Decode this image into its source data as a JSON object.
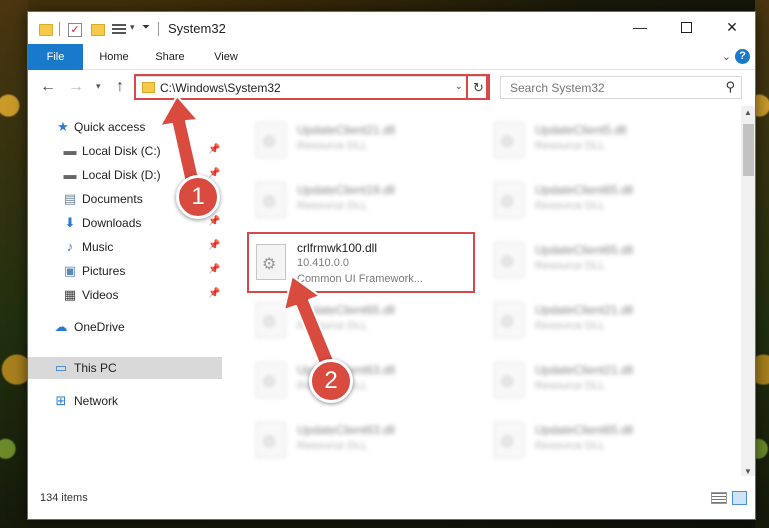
{
  "window": {
    "title": "System32"
  },
  "quick_access_toolbar": {
    "icons": [
      "folder-icon",
      "properties-check-icon",
      "new-folder-icon",
      "properties-icon",
      "dropdown-icon"
    ]
  },
  "ribbon": {
    "tabs": [
      "File",
      "Home",
      "Share",
      "View"
    ],
    "accent_color": "#1979ca",
    "help_label": "?"
  },
  "navigation": {
    "address": "C:\\Windows\\System32",
    "search_placeholder": "Search System32"
  },
  "sidebar": {
    "items": [
      {
        "label": "Quick access",
        "icon": "star-icon"
      },
      {
        "label": "Local Disk (C:)",
        "icon": "drive-icon",
        "pinned": true
      },
      {
        "label": "Local Disk (D:)",
        "icon": "drive-icon",
        "pinned": true
      },
      {
        "label": "Documents",
        "icon": "documents-icon",
        "pinned": true
      },
      {
        "label": "Downloads",
        "icon": "downloads-icon",
        "pinned": true
      },
      {
        "label": "Music",
        "icon": "music-icon",
        "pinned": true
      },
      {
        "label": "Pictures",
        "icon": "pictures-icon",
        "pinned": true
      },
      {
        "label": "Videos",
        "icon": "videos-icon",
        "pinned": true
      },
      {
        "label": "OneDrive",
        "icon": "cloud-icon"
      },
      {
        "label": "This PC",
        "icon": "computer-icon",
        "selected": true
      },
      {
        "label": "Network",
        "icon": "network-icon"
      }
    ]
  },
  "files": {
    "col_left": [
      {
        "name": "UpdateClient21.dll",
        "desc": "Resource DLL"
      },
      {
        "name": "UpdateClient19.dll",
        "desc": "Resource DLL"
      },
      {
        "name": "UpdateClient65.dll",
        "desc": "Resource DLL"
      },
      {
        "name": "UpdateClient63.dll",
        "desc": "Resource DLL"
      },
      {
        "name": "UpdateClient63.dll",
        "desc": "Resource DLL"
      }
    ],
    "col_right": [
      {
        "name": "UpdateClient5.dll",
        "desc": "Resource DLL"
      },
      {
        "name": "UpdateClient65.dll",
        "desc": "Resource DLL"
      },
      {
        "name": "UpdateClient65.dll",
        "desc": "Resource DLL"
      },
      {
        "name": "UpdateClient21.dll",
        "desc": "Resource DLL"
      },
      {
        "name": "UpdateClient21.dll",
        "desc": "Resource DLL"
      },
      {
        "name": "UpdateClient65.dll",
        "desc": "Resource DLL"
      }
    ],
    "focused": {
      "name": "crlfrmwk100.dll",
      "version": "10.410.0.0",
      "desc": "Common UI Framework..."
    }
  },
  "status": {
    "item_count": "134 items"
  },
  "callouts": {
    "step1": "1",
    "step2": "2",
    "color": "#d94a3f"
  }
}
